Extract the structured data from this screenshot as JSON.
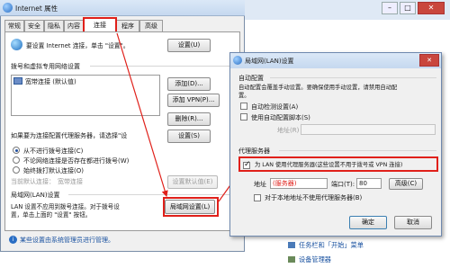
{
  "internet_props": {
    "title": "Internet 属性",
    "tabs": [
      "常规",
      "安全",
      "隐私",
      "内容",
      "连接",
      "程序",
      "高级"
    ],
    "setup_text": "要设置 Internet 连接，单击 \"设置\"。",
    "setup_btn": "设置(U)",
    "dialup_header": "拨号和虚拟专用网络设置",
    "list_item": "宽带连接 (默认值)",
    "add_btn": "添加(D)...",
    "add_vpn_btn": "添加 VPN(P)...",
    "remove_btn": "删除(R)...",
    "proxy_hint": "如果要为连接配置代理服务器，请选择\"设",
    "settings_btn": "设置(S)",
    "radio_never": "从不进行拨号连接(C)",
    "radio_when_none": "不论网络连接是否存在都进行拨号(W)",
    "radio_always": "始终拨打默认连接(O)",
    "current_label": "当前默认连接：",
    "current_value": "宽带连接",
    "set_default_btn": "设置默认值(E)",
    "lan_header": "局域网(LAN)设置",
    "lan_text_1": "LAN 设置不应用到拨号连接。对于拨号设",
    "lan_text_2": "置，单击上面的 \"设置\" 按钮。",
    "lan_btn": "局域网设置(L)",
    "footer_note": "某些设置由系统管理员进行管理。"
  },
  "lan_dialog": {
    "title": "局域网(LAN)设置",
    "auto_header": "自动配置",
    "auto_desc": "自动配置会覆盖手动设置。要确保使用手动设置，请禁用自动配",
    "auto_desc_2": "置。",
    "auto_detect": "自动检测设置(A)",
    "use_script": "使用自动配置脚本(S)",
    "address_label": "地址(R)",
    "proxy_header": "代理服务器",
    "use_proxy": "为 LAN 使用代理服务器(这些设置不用于拨号或 VPN 连接)",
    "addr_label": "地址",
    "server_placeholder": "(服务器)",
    "port_label": "端口(T):",
    "port_value": "80",
    "advanced_btn": "高级(C)",
    "bypass_local": "对于本地地址不使用代理服务器(B)",
    "ok_btn": "确定",
    "cancel_btn": "取消"
  },
  "background": {
    "item1": "任务栏和「开始」菜单",
    "item2": "设备管理器"
  },
  "colors": {
    "accent": "#e0201a",
    "titlebar": "#d5e4f5",
    "dialog_bg": "#f0f0f0"
  }
}
